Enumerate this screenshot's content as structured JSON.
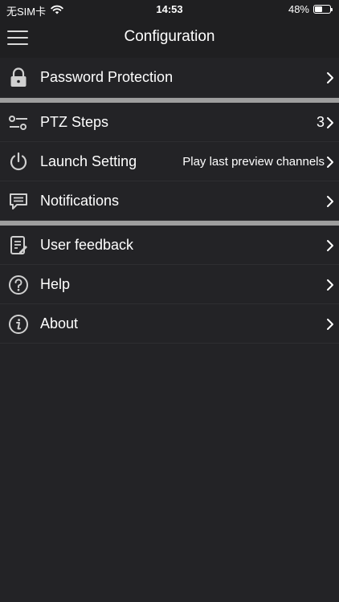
{
  "status_bar": {
    "carrier": "无SIM卡",
    "time": "14:53",
    "battery": "48%",
    "battery_level": 0.48
  },
  "header": {
    "title": "Configuration"
  },
  "groups": [
    {
      "items": [
        {
          "label": "Password Protection",
          "value": "",
          "icon": "lock-icon"
        }
      ]
    },
    {
      "items": [
        {
          "label": "PTZ Steps",
          "value": "3",
          "icon": "sliders-icon"
        },
        {
          "label": "Launch Setting",
          "value": "Play last preview channels",
          "icon": "power-icon"
        },
        {
          "label": "Notifications",
          "value": "",
          "icon": "message-icon"
        }
      ]
    },
    {
      "items": [
        {
          "label": "User feedback",
          "value": "",
          "icon": "feedback-icon"
        },
        {
          "label": "Help",
          "value": "",
          "icon": "help-icon"
        },
        {
          "label": "About",
          "value": "",
          "icon": "info-icon"
        }
      ]
    }
  ]
}
